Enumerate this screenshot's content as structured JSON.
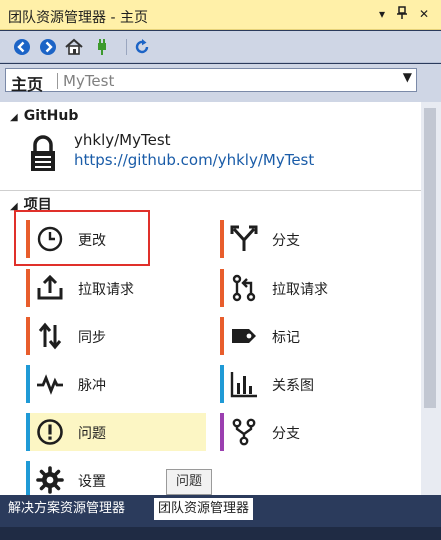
{
  "window": {
    "title": "团队资源管理器 - 主页",
    "controls": {
      "dropdown": "▾",
      "pin": "📌",
      "close": "✕"
    }
  },
  "toolbar": {
    "icons": [
      "back-icon",
      "forward-icon",
      "home-icon",
      "connect-icon",
      "refresh-icon"
    ]
  },
  "home_selector": {
    "prefix": "主页",
    "separator": "|",
    "repo": "MyTest",
    "caret": "▼"
  },
  "github": {
    "section_label": "GitHub",
    "repo_name": "yhkly/MyTest",
    "repo_url": "https://github.com/yhkly/MyTest"
  },
  "project": {
    "section_label": "项目",
    "tiles_left": [
      {
        "label": "更改",
        "icon": "clock-icon",
        "accent": "#e85d2c"
      },
      {
        "label": "拉取请求",
        "icon": "pull-request-upload-icon",
        "accent": "#e85d2c"
      },
      {
        "label": "同步",
        "icon": "sync-arrows-icon",
        "accent": "#e85d2c"
      },
      {
        "label": "脉冲",
        "icon": "pulse-icon",
        "accent": "#1f9ad6"
      },
      {
        "label": "问题",
        "icon": "issue-icon",
        "accent": "#1f9ad6",
        "highlighted": true
      },
      {
        "label": "设置",
        "icon": "gear-icon",
        "accent": "#1f9ad6"
      }
    ],
    "tiles_right": [
      {
        "label": "分支",
        "icon": "branch-icon",
        "accent": "#e85d2c"
      },
      {
        "label": "拉取请求",
        "icon": "pull-request-icon",
        "accent": "#e85d2c"
      },
      {
        "label": "标记",
        "icon": "tag-icon",
        "accent": "#e85d2c"
      },
      {
        "label": "关系图",
        "icon": "graph-icon",
        "accent": "#1f9ad6"
      },
      {
        "label": "分支",
        "icon": "fork-icon",
        "accent": "#9b3fb0"
      }
    ]
  },
  "tooltip": {
    "text": "问题"
  },
  "bottom_tabs": [
    {
      "label": "解决方案资源管理器",
      "active": false
    },
    {
      "label": "团队资源管理器",
      "active": true
    }
  ],
  "colors": {
    "title_bg": "#fff0a8",
    "accent_orange": "#e85d2c",
    "accent_blue": "#1f9ad6",
    "accent_purple": "#9b3fb0",
    "highlight_bg": "#fcf6c4",
    "selection_border": "#e0302a"
  }
}
